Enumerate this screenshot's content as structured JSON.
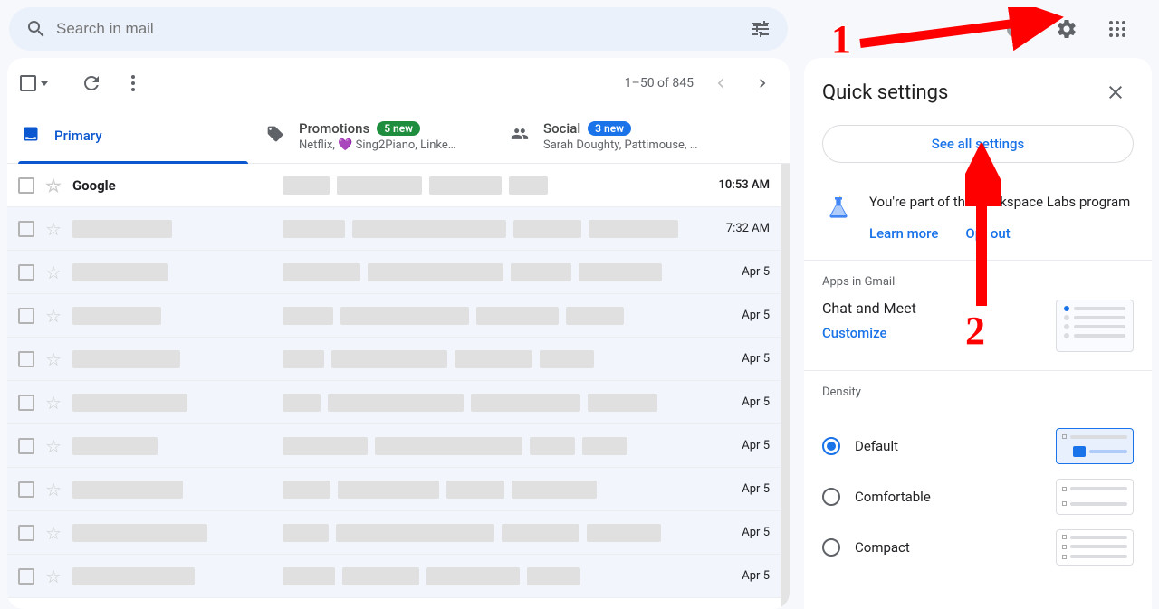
{
  "search": {
    "placeholder": "Search in mail"
  },
  "pager": {
    "label": "1–50 of 845"
  },
  "tabs": {
    "primary": {
      "label": "Primary"
    },
    "promotions": {
      "label": "Promotions",
      "badge": "5 new",
      "sub": "Netflix, 💜 Sing2Piano, Linke…"
    },
    "social": {
      "label": "Social",
      "badge": "3 new",
      "sub": "Sarah Doughty, Pattimouse, …"
    }
  },
  "emails": [
    {
      "sender": "Google",
      "date": "10:53 AM",
      "unread": true
    },
    {
      "sender": "",
      "date": "7:32 AM",
      "unread": false
    },
    {
      "sender": "",
      "date": "Apr 5",
      "unread": false
    },
    {
      "sender": "",
      "date": "Apr 5",
      "unread": false
    },
    {
      "sender": "",
      "date": "Apr 5",
      "unread": false
    },
    {
      "sender": "",
      "date": "Apr 5",
      "unread": false
    },
    {
      "sender": "",
      "date": "Apr 5",
      "unread": false
    },
    {
      "sender": "",
      "date": "Apr 5",
      "unread": false
    },
    {
      "sender": "",
      "date": "Apr 5",
      "unread": false
    },
    {
      "sender": "",
      "date": "Apr 5",
      "unread": false
    }
  ],
  "settings": {
    "title": "Quick settings",
    "see_all": "See all settings",
    "labs": {
      "text": "You're part of the Workspace Labs program",
      "learn_more": "Learn more",
      "opt_out": "Opt out"
    },
    "apps": {
      "header": "Apps in Gmail",
      "title": "Chat and Meet",
      "customize": "Customize"
    },
    "density": {
      "header": "Density",
      "options": [
        {
          "label": "Default",
          "selected": true
        },
        {
          "label": "Comfortable",
          "selected": false
        },
        {
          "label": "Compact",
          "selected": false
        }
      ]
    }
  },
  "annotations": {
    "num1": "1",
    "num2": "2"
  }
}
